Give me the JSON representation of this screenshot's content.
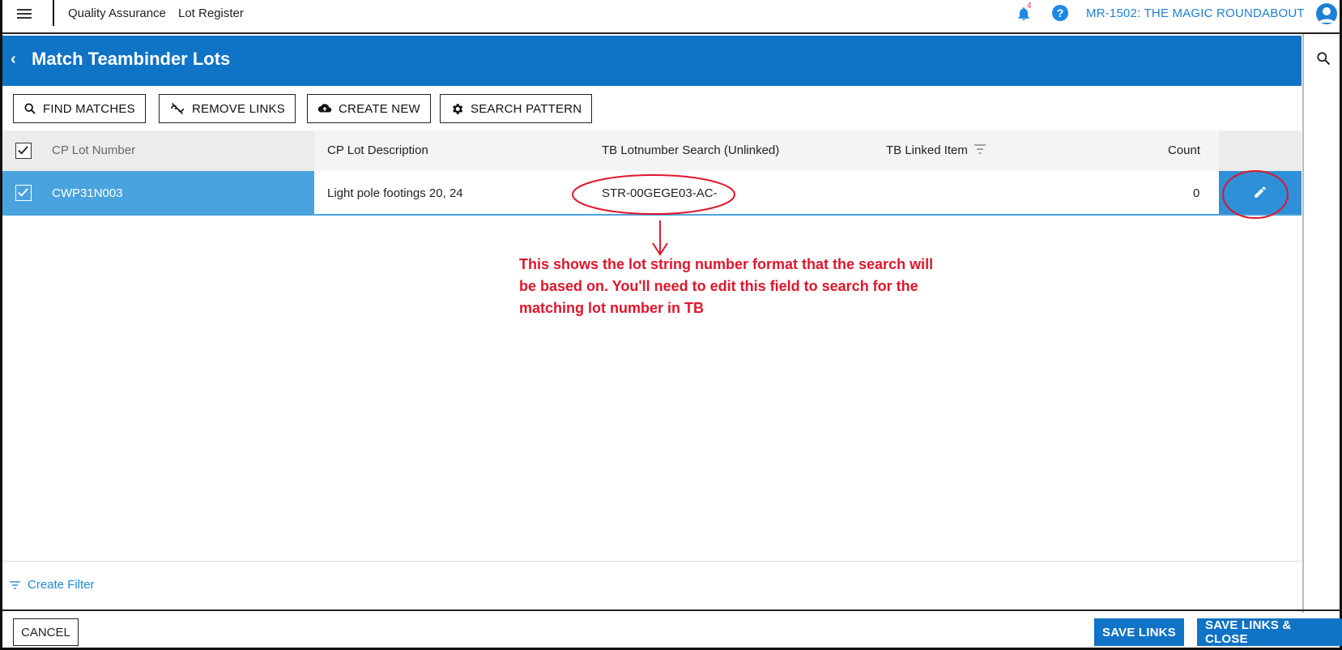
{
  "topbar": {
    "module": "Quality Assurance",
    "page": "Lot Register",
    "notification_count": "4",
    "help_label": "?",
    "project": "MR-1502: THE MAGIC ROUNDABOUT"
  },
  "dialog": {
    "title": "Match Teambinder Lots",
    "back_label": "‹"
  },
  "toolbar": {
    "find_matches": "FIND MATCHES",
    "remove_links": "REMOVE LINKS",
    "create_new": "CREATE NEW",
    "search_pattern": "SEARCH PATTERN"
  },
  "table": {
    "columns": {
      "cp_lot_number": "CP Lot Number",
      "cp_lot_description": "CP Lot Description",
      "tb_lotnumber_search": "TB Lotnumber Search (Unlinked)",
      "tb_linked_item": "TB Linked Item",
      "count": "Count"
    },
    "rows": [
      {
        "selected": true,
        "cp_lot_number": "CWP31N003",
        "cp_lot_description": "Light pole footings 20, 24",
        "tb_lotnumber_search": "STR-00GEGE03-AC-",
        "tb_linked_item": "",
        "count": "0"
      }
    ]
  },
  "annotation": {
    "text": "This shows the lot string number format that the search will be based on. You'll need to edit this field to search for the matching lot number in TB",
    "color": "#e0162b"
  },
  "footer": {
    "create_filter": "Create Filter",
    "cancel": "CANCEL",
    "save_links": "SAVE LINKS",
    "save_links_close": "SAVE LINKS & CLOSE"
  },
  "colors": {
    "primary": "#0f73c6",
    "selected_row": "#4aa3df",
    "link": "#1e88d6"
  }
}
